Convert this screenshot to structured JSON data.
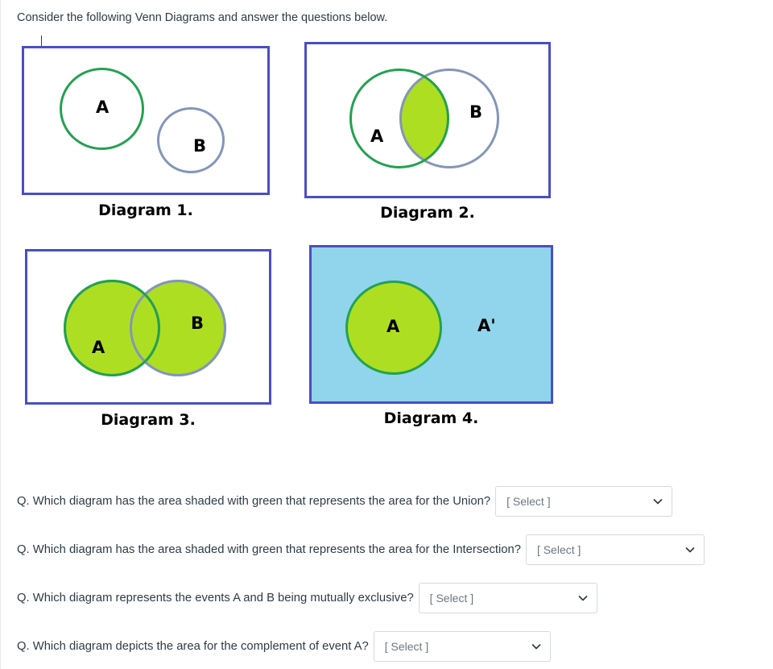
{
  "intro": {
    "text": "Consider the following Venn Diagrams and answer the questions below."
  },
  "colors": {
    "box_border": "#4a4ec4",
    "circle_a_stroke": "#23a152",
    "circle_b_stroke": "#8496b8",
    "shade_green": "#aede22",
    "shade_blue": "#90d5ec",
    "text": "#2d3b45",
    "select_border": "#d6d9dc",
    "select_text": "#6b7780"
  },
  "diagrams": [
    {
      "id": "diagram-1",
      "caption": "Diagram 1.",
      "set_a_label": "A",
      "set_b_label": "B",
      "shading": "none",
      "overlap": false,
      "description": "Two disjoint circles A and B, unshaded, inside a rectangle"
    },
    {
      "id": "diagram-2",
      "caption": "Diagram 2.",
      "set_a_label": "A",
      "set_b_label": "B",
      "shading": "intersection",
      "overlap": true,
      "description": "Two overlapping circles with only the intersection shaded green"
    },
    {
      "id": "diagram-3",
      "caption": "Diagram 3.",
      "set_a_label": "A",
      "set_b_label": "B",
      "shading": "union",
      "overlap": true,
      "description": "Two overlapping circles both fully shaded green (union)"
    },
    {
      "id": "diagram-4",
      "caption": "Diagram 4.",
      "set_a_label": "A",
      "set_b_label": "A'",
      "shading": "complement",
      "overlap": false,
      "description": "Rectangle shaded light blue with a green circle A inside and region A' outside the circle"
    }
  ],
  "questions": [
    {
      "id": "q-union",
      "text": "Q. Which diagram has the area shaded with green that represents the area for the Union?",
      "select_value": "[ Select ]",
      "select_width": 220
    },
    {
      "id": "q-intersection",
      "text": "Q. Which diagram has the area shaded with green that represents the area for the Intersection?",
      "select_value": "[ Select ]",
      "select_width": 222
    },
    {
      "id": "q-mutually-exclusive",
      "text": "Q. Which diagram represents the events A and B being mutually exclusive?",
      "select_value": "[ Select ]",
      "select_width": 222
    },
    {
      "id": "q-complement",
      "text": "Q. Which diagram depicts the area for the complement of event A?",
      "select_value": "[ Select ]",
      "select_width": 220
    }
  ]
}
